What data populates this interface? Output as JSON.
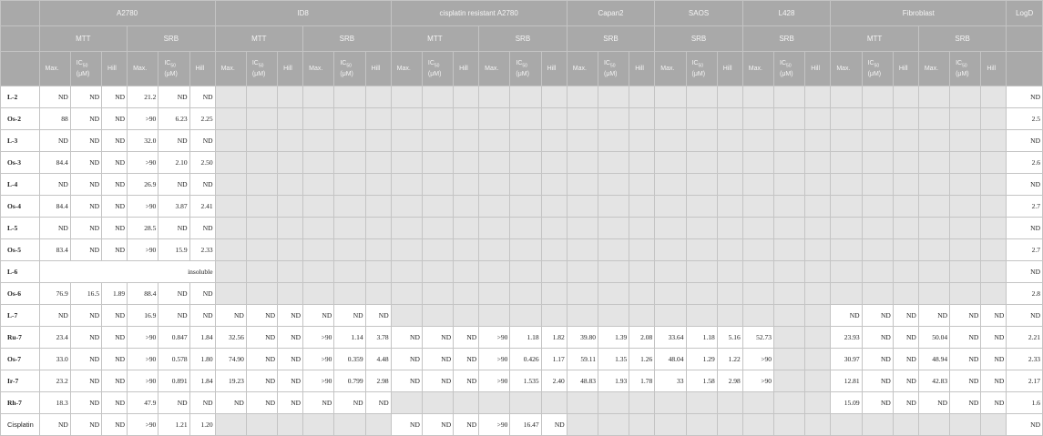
{
  "header": {
    "cell_lines": [
      {
        "name": "A2780"
      },
      {
        "name": "ID8"
      },
      {
        "name": "cisplatin resistant A2780"
      },
      {
        "name": "Capan2"
      },
      {
        "name": "SAOS"
      },
      {
        "name": "L428"
      },
      {
        "name": "Fibroblast"
      }
    ],
    "logd_label": "LogD",
    "mtt_label": "MTT",
    "srb_label": "SRB",
    "max_label": "Max.",
    "ic_label": "IC",
    "ic_sub": "50",
    "ic_unit": "(μM)",
    "hill_label": "Hill",
    "insoluble_label": "insoluble"
  },
  "rows": [
    {
      "label": "L-2",
      "bold": true,
      "a": [
        "ND",
        "ND",
        "ND",
        "21.2",
        "ND",
        "ND"
      ],
      "rest": null,
      "logd": "ND"
    },
    {
      "label": "Os-2",
      "bold": true,
      "a": [
        "88",
        "ND",
        "ND",
        ">90",
        "6.23",
        "2.25"
      ],
      "rest": null,
      "logd": "2.5"
    },
    {
      "label": "L-3",
      "bold": true,
      "a": [
        "ND",
        "ND",
        "ND",
        "32.0",
        "ND",
        "ND"
      ],
      "rest": null,
      "logd": "ND"
    },
    {
      "label": "Os-3",
      "bold": true,
      "a": [
        "84.4",
        "ND",
        "ND",
        ">90",
        "2.10",
        "2.50"
      ],
      "rest": null,
      "logd": "2.6"
    },
    {
      "label": "L-4",
      "bold": true,
      "a": [
        "ND",
        "ND",
        "ND",
        "26.9",
        "ND",
        "ND"
      ],
      "rest": null,
      "logd": "ND"
    },
    {
      "label": "Os-4",
      "bold": true,
      "a": [
        "84.4",
        "ND",
        "ND",
        ">90",
        "3.87",
        "2.41"
      ],
      "rest": null,
      "logd": "2.7"
    },
    {
      "label": "L-5",
      "bold": true,
      "a": [
        "ND",
        "ND",
        "ND",
        "28.5",
        "ND",
        "ND"
      ],
      "rest": null,
      "logd": "ND"
    },
    {
      "label": "Os-5",
      "bold": true,
      "a": [
        "83.4",
        "ND",
        "ND",
        ">90",
        "15.9",
        "2.33"
      ],
      "rest": null,
      "logd": "2.7"
    },
    {
      "label": "L-6",
      "bold": true,
      "insoluble": true,
      "logd": "ND"
    },
    {
      "label": "Os-6",
      "bold": true,
      "a": [
        "76.9",
        "16.5",
        "1.89",
        "88.4",
        "ND",
        "ND"
      ],
      "rest": null,
      "logd": "2.8"
    },
    {
      "label": "L-7",
      "bold": true,
      "a": [
        "ND",
        "ND",
        "ND",
        "16.9",
        "ND",
        "ND"
      ],
      "rest": {
        "id8": [
          "ND",
          "ND",
          "ND",
          "ND",
          "ND",
          "ND"
        ],
        "cis": null,
        "capan": null,
        "saos": null,
        "l428": null,
        "fib": [
          "ND",
          "ND",
          "ND",
          "ND",
          "ND",
          "ND"
        ]
      },
      "logd": "ND"
    },
    {
      "label": "Ru-7",
      "bold": true,
      "a": [
        "23.4",
        "ND",
        "ND",
        ">90",
        "0.847",
        "1.84"
      ],
      "rest": {
        "id8": [
          "32.56",
          "ND",
          "ND",
          ">90",
          "1.14",
          "3.78"
        ],
        "cis": [
          "ND",
          "ND",
          "ND",
          ">90",
          "1.18",
          "1.82"
        ],
        "capan": [
          "39.80",
          "1.39",
          "2.08"
        ],
        "saos": [
          "33.64",
          "1.18",
          "5.16"
        ],
        "l428": [
          "52.73",
          "",
          ""
        ],
        "fib": [
          "23.93",
          "ND",
          "ND",
          "50.04",
          "ND",
          "ND"
        ]
      },
      "logd": "2.21"
    },
    {
      "label": "Os-7",
      "bold": true,
      "a": [
        "33.0",
        "ND",
        "ND",
        ">90",
        "0.578",
        "1.80"
      ],
      "rest": {
        "id8": [
          "74.90",
          "ND",
          "ND",
          ">90",
          "0.359",
          "4.48"
        ],
        "cis": [
          "ND",
          "ND",
          "ND",
          ">90",
          "0.426",
          "1.17"
        ],
        "capan": [
          "59.11",
          "1.35",
          "1.26"
        ],
        "saos": [
          "48.04",
          "1.29",
          "1.22"
        ],
        "l428": [
          ">90",
          "",
          ""
        ],
        "fib": [
          "30.97",
          "ND",
          "ND",
          "48.94",
          "ND",
          "ND"
        ]
      },
      "logd": "2.33"
    },
    {
      "label": "Ir-7",
      "bold": true,
      "a": [
        "23.2",
        "ND",
        "ND",
        ">90",
        "0.891",
        "1.84"
      ],
      "rest": {
        "id8": [
          "19.23",
          "ND",
          "ND",
          ">90",
          "0.799",
          "2.98"
        ],
        "cis": [
          "ND",
          "ND",
          "ND",
          ">90",
          "1.535",
          "2.40"
        ],
        "capan": [
          "48.83",
          "1.93",
          "1.78"
        ],
        "saos": [
          "33",
          "1.58",
          "2.98"
        ],
        "l428": [
          ">90",
          "",
          ""
        ],
        "fib": [
          "12.81",
          "ND",
          "ND",
          "42.83",
          "ND",
          "ND"
        ]
      },
      "logd": "2.17"
    },
    {
      "label": "Rh-7",
      "bold": true,
      "a": [
        "18.3",
        "ND",
        "ND",
        "47.9",
        "ND",
        "ND"
      ],
      "rest": {
        "id8": [
          "ND",
          "ND",
          "ND",
          "ND",
          "ND",
          "ND"
        ],
        "cis": null,
        "capan": null,
        "saos": null,
        "l428": null,
        "fib": [
          "15.09",
          "ND",
          "ND",
          "ND",
          "ND",
          "ND"
        ]
      },
      "logd": "1.6"
    },
    {
      "label": "Cisplatin",
      "bold": false,
      "a": [
        "ND",
        "ND",
        "ND",
        ">90",
        "1.21",
        "1.20"
      ],
      "rest": {
        "id8": null,
        "cis": [
          "ND",
          "ND",
          "ND",
          ">90",
          "16.47",
          "ND"
        ],
        "capan": null,
        "saos": null,
        "l428": null,
        "fib": null
      },
      "logd": "ND"
    }
  ]
}
